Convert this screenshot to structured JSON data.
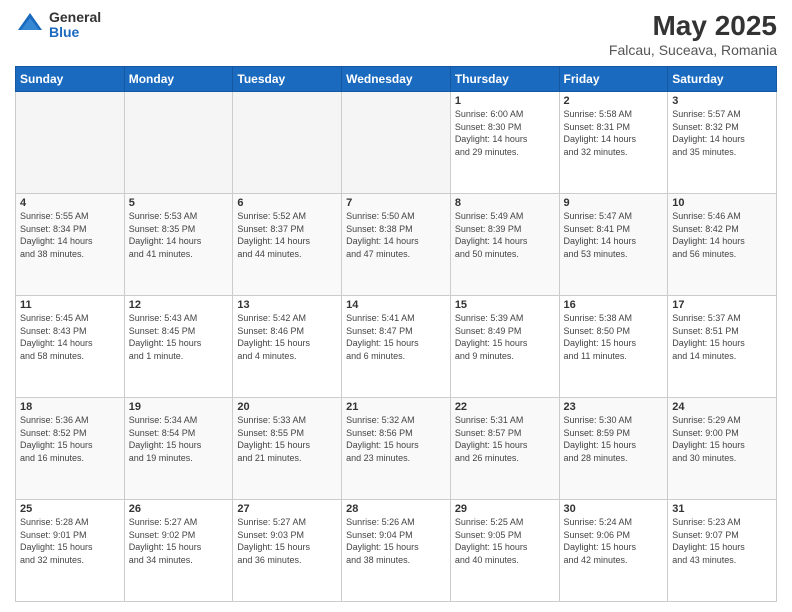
{
  "logo": {
    "general": "General",
    "blue": "Blue"
  },
  "header": {
    "title": "May 2025",
    "subtitle": "Falcau, Suceava, Romania"
  },
  "weekdays": [
    "Sunday",
    "Monday",
    "Tuesday",
    "Wednesday",
    "Thursday",
    "Friday",
    "Saturday"
  ],
  "weeks": [
    [
      {
        "day": "",
        "info": ""
      },
      {
        "day": "",
        "info": ""
      },
      {
        "day": "",
        "info": ""
      },
      {
        "day": "",
        "info": ""
      },
      {
        "day": "1",
        "info": "Sunrise: 6:00 AM\nSunset: 8:30 PM\nDaylight: 14 hours\nand 29 minutes."
      },
      {
        "day": "2",
        "info": "Sunrise: 5:58 AM\nSunset: 8:31 PM\nDaylight: 14 hours\nand 32 minutes."
      },
      {
        "day": "3",
        "info": "Sunrise: 5:57 AM\nSunset: 8:32 PM\nDaylight: 14 hours\nand 35 minutes."
      }
    ],
    [
      {
        "day": "4",
        "info": "Sunrise: 5:55 AM\nSunset: 8:34 PM\nDaylight: 14 hours\nand 38 minutes."
      },
      {
        "day": "5",
        "info": "Sunrise: 5:53 AM\nSunset: 8:35 PM\nDaylight: 14 hours\nand 41 minutes."
      },
      {
        "day": "6",
        "info": "Sunrise: 5:52 AM\nSunset: 8:37 PM\nDaylight: 14 hours\nand 44 minutes."
      },
      {
        "day": "7",
        "info": "Sunrise: 5:50 AM\nSunset: 8:38 PM\nDaylight: 14 hours\nand 47 minutes."
      },
      {
        "day": "8",
        "info": "Sunrise: 5:49 AM\nSunset: 8:39 PM\nDaylight: 14 hours\nand 50 minutes."
      },
      {
        "day": "9",
        "info": "Sunrise: 5:47 AM\nSunset: 8:41 PM\nDaylight: 14 hours\nand 53 minutes."
      },
      {
        "day": "10",
        "info": "Sunrise: 5:46 AM\nSunset: 8:42 PM\nDaylight: 14 hours\nand 56 minutes."
      }
    ],
    [
      {
        "day": "11",
        "info": "Sunrise: 5:45 AM\nSunset: 8:43 PM\nDaylight: 14 hours\nand 58 minutes."
      },
      {
        "day": "12",
        "info": "Sunrise: 5:43 AM\nSunset: 8:45 PM\nDaylight: 15 hours\nand 1 minute."
      },
      {
        "day": "13",
        "info": "Sunrise: 5:42 AM\nSunset: 8:46 PM\nDaylight: 15 hours\nand 4 minutes."
      },
      {
        "day": "14",
        "info": "Sunrise: 5:41 AM\nSunset: 8:47 PM\nDaylight: 15 hours\nand 6 minutes."
      },
      {
        "day": "15",
        "info": "Sunrise: 5:39 AM\nSunset: 8:49 PM\nDaylight: 15 hours\nand 9 minutes."
      },
      {
        "day": "16",
        "info": "Sunrise: 5:38 AM\nSunset: 8:50 PM\nDaylight: 15 hours\nand 11 minutes."
      },
      {
        "day": "17",
        "info": "Sunrise: 5:37 AM\nSunset: 8:51 PM\nDaylight: 15 hours\nand 14 minutes."
      }
    ],
    [
      {
        "day": "18",
        "info": "Sunrise: 5:36 AM\nSunset: 8:52 PM\nDaylight: 15 hours\nand 16 minutes."
      },
      {
        "day": "19",
        "info": "Sunrise: 5:34 AM\nSunset: 8:54 PM\nDaylight: 15 hours\nand 19 minutes."
      },
      {
        "day": "20",
        "info": "Sunrise: 5:33 AM\nSunset: 8:55 PM\nDaylight: 15 hours\nand 21 minutes."
      },
      {
        "day": "21",
        "info": "Sunrise: 5:32 AM\nSunset: 8:56 PM\nDaylight: 15 hours\nand 23 minutes."
      },
      {
        "day": "22",
        "info": "Sunrise: 5:31 AM\nSunset: 8:57 PM\nDaylight: 15 hours\nand 26 minutes."
      },
      {
        "day": "23",
        "info": "Sunrise: 5:30 AM\nSunset: 8:59 PM\nDaylight: 15 hours\nand 28 minutes."
      },
      {
        "day": "24",
        "info": "Sunrise: 5:29 AM\nSunset: 9:00 PM\nDaylight: 15 hours\nand 30 minutes."
      }
    ],
    [
      {
        "day": "25",
        "info": "Sunrise: 5:28 AM\nSunset: 9:01 PM\nDaylight: 15 hours\nand 32 minutes."
      },
      {
        "day": "26",
        "info": "Sunrise: 5:27 AM\nSunset: 9:02 PM\nDaylight: 15 hours\nand 34 minutes."
      },
      {
        "day": "27",
        "info": "Sunrise: 5:27 AM\nSunset: 9:03 PM\nDaylight: 15 hours\nand 36 minutes."
      },
      {
        "day": "28",
        "info": "Sunrise: 5:26 AM\nSunset: 9:04 PM\nDaylight: 15 hours\nand 38 minutes."
      },
      {
        "day": "29",
        "info": "Sunrise: 5:25 AM\nSunset: 9:05 PM\nDaylight: 15 hours\nand 40 minutes."
      },
      {
        "day": "30",
        "info": "Sunrise: 5:24 AM\nSunset: 9:06 PM\nDaylight: 15 hours\nand 42 minutes."
      },
      {
        "day": "31",
        "info": "Sunrise: 5:23 AM\nSunset: 9:07 PM\nDaylight: 15 hours\nand 43 minutes."
      }
    ]
  ]
}
